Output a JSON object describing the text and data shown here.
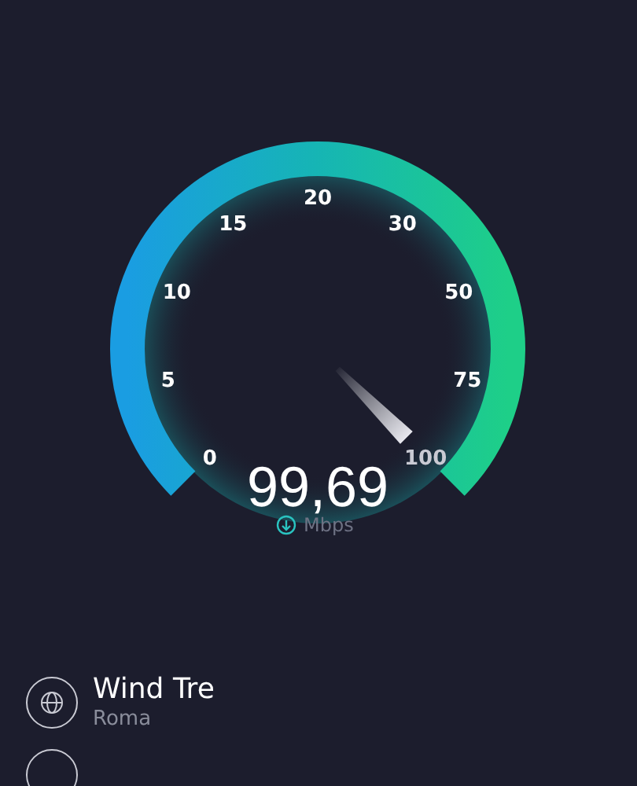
{
  "gauge": {
    "ticks": [
      "0",
      "5",
      "10",
      "15",
      "20",
      "30",
      "50",
      "75",
      "100"
    ],
    "reading": "99,69",
    "unit": "Mbps"
  },
  "server": {
    "provider": "Wind Tre",
    "location": "Roma"
  }
}
